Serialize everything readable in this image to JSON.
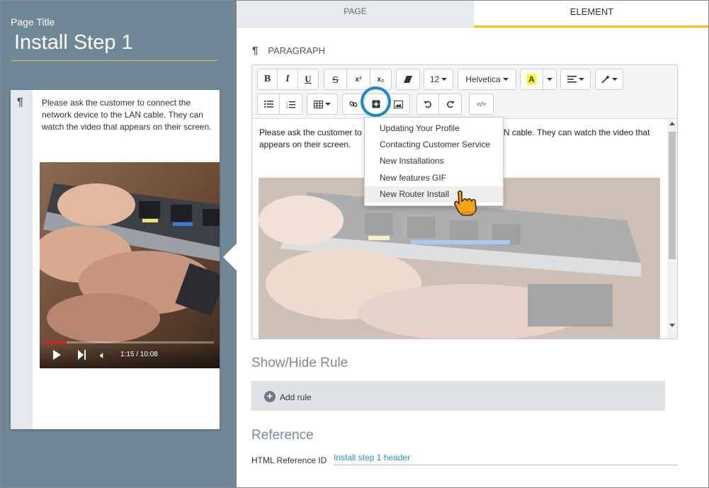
{
  "left_panel": {
    "page_title_label": "Page Title",
    "page_title_value": "Install Step 1",
    "card_icon": "pilcrow-icon",
    "card_text": "Please ask the customer to connect the network device to the LAN cable. They can watch the video that appears on their screen.",
    "video": {
      "time": "1:15 / 10:08",
      "progress_fraction": 0.124,
      "play_icon": "play-icon",
      "next_icon": "next-icon",
      "volume_icon": "volume-icon"
    }
  },
  "tabs": [
    {
      "label": "PAGE",
      "active": false
    },
    {
      "label": "ELEMENT",
      "active": true
    }
  ],
  "element": {
    "type_label": "PARAGRAPH",
    "type_icon": "pilcrow-icon"
  },
  "toolbar": {
    "bold": "B",
    "italic": "I",
    "underline": "U",
    "strike": "S",
    "superscript": "x²",
    "subscript": "x₂",
    "font_size": "12",
    "font_family": "Helvetica",
    "highlight_letter": "A",
    "code": "</>",
    "highlight_color": "#ffff00",
    "accent_ring_color": "#1c86c6"
  },
  "editor": {
    "text": "Please ask the customer to connect the network device to the LAN cable. They can watch the video that appears on their screen."
  },
  "insert_dropdown": {
    "items": [
      "Updating Your Profile",
      "Contacting Customer Service",
      "New Installations",
      "New features GIF",
      "New Router Install"
    ],
    "active_index": 4
  },
  "show_hide": {
    "title": "Show/Hide Rule",
    "add_rule_label": "Add rule"
  },
  "reference": {
    "title": "Reference",
    "field_label": "HTML Reference ID",
    "field_value": "Install step 1 header"
  },
  "colors": {
    "sidebar": "#6f8797",
    "tab_active_underline": "#f0c21b",
    "link": "#2a8fd0"
  }
}
